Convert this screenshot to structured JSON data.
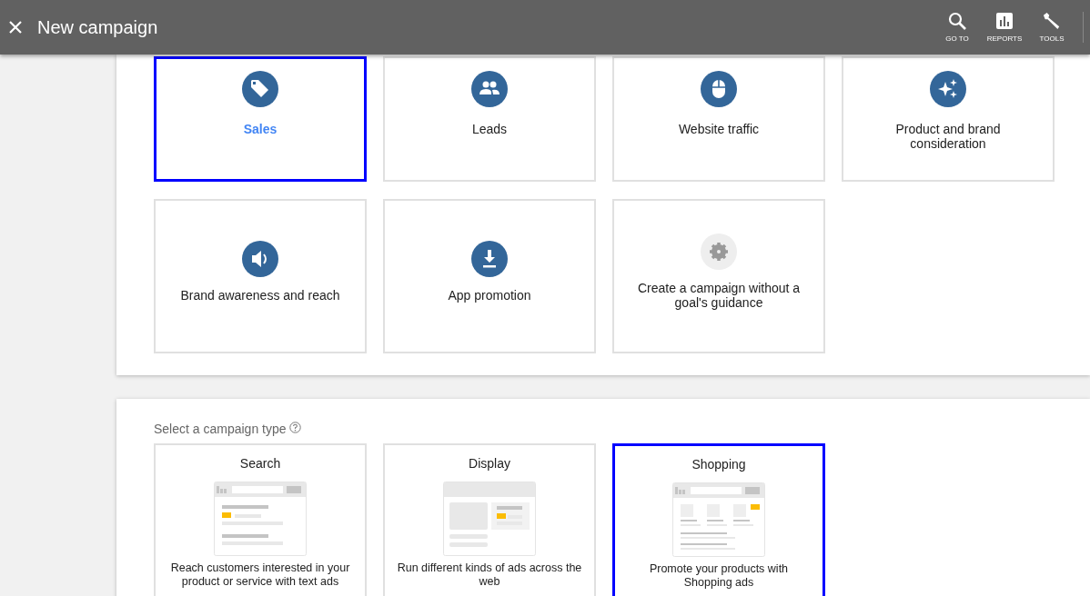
{
  "header": {
    "title": "New campaign",
    "actions": [
      {
        "kind": "search",
        "label": "GO TO"
      },
      {
        "kind": "reports",
        "label": "REPORTS"
      },
      {
        "kind": "tools",
        "label": "TOOLS"
      }
    ]
  },
  "goals": [
    {
      "kind": "tag",
      "label": "Sales",
      "selected": true
    },
    {
      "kind": "people",
      "label": "Leads",
      "selected": false
    },
    {
      "kind": "mouse",
      "label": "Website traffic",
      "selected": false
    },
    {
      "kind": "sparkle",
      "label": "Product and brand consideration",
      "selected": false
    },
    {
      "kind": "speaker",
      "label": "Brand awareness and reach",
      "selected": false
    },
    {
      "kind": "download",
      "label": "App promotion",
      "selected": false
    },
    {
      "kind": "gear",
      "label": "Create a campaign without a goal's guidance",
      "selected": false
    }
  ],
  "campaign_type": {
    "label": "Select a campaign type",
    "types": [
      {
        "kind": "search",
        "title": "Search",
        "description": "Reach customers interested in your product or service with text ads",
        "selected": false
      },
      {
        "kind": "display",
        "title": "Display",
        "description": "Run different kinds of ads across the web",
        "selected": false
      },
      {
        "kind": "shopping",
        "title": "Shopping",
        "description": "Promote your products with Shopping ads",
        "selected": true
      }
    ]
  }
}
